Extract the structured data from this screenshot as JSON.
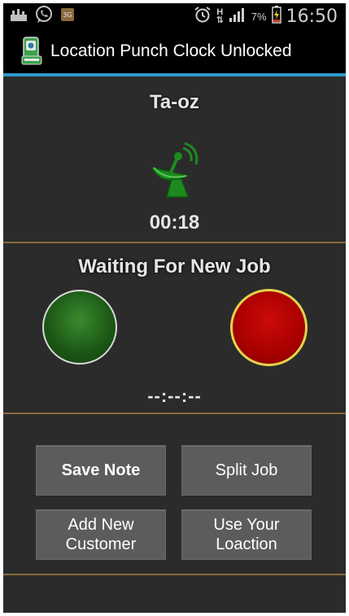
{
  "status_bar": {
    "time": "16:50",
    "battery_percent": "7%",
    "network": "H",
    "icons": [
      "usb-icon",
      "whatsapp-icon",
      "3g-icon",
      "alarm-icon",
      "h-network-icon",
      "signal-icon",
      "battery-charging-icon"
    ]
  },
  "app": {
    "title": "Location Punch Clock Unlocked",
    "accent_color": "#2e9ac9"
  },
  "main": {
    "name": "Ta-oz",
    "timer": "00:18",
    "status": "Waiting For New Job",
    "elapsed": "--:--:--",
    "start_color": "#1d5a16",
    "stop_color": "#a80000"
  },
  "buttons": {
    "save_note": "Save Note",
    "split_job": "Split Job",
    "add_new_customer_line1": "Add New",
    "add_new_customer_line2": "Customer",
    "use_location_line1": "Use Your",
    "use_location_line2": "Loaction"
  }
}
